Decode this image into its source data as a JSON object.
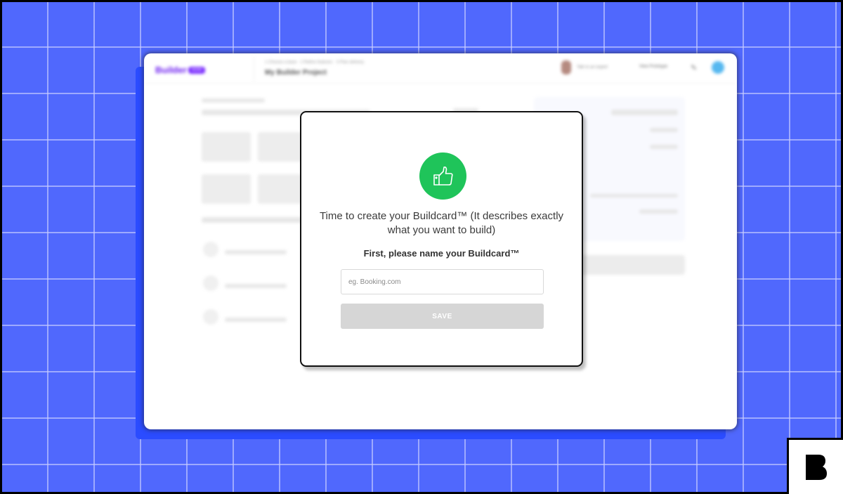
{
  "app": {
    "logo_text": "Builder",
    "logo_badge": "NOW",
    "steps": "1 Choose a base · 2 Refine features · 3 Plan delivery",
    "project_title": "My Builder Project",
    "support_label": "Talk to an expert",
    "view_prototype_label": "View Prototype",
    "icons": {
      "edit": "pencil-icon",
      "user": "user-avatar-icon"
    }
  },
  "modal": {
    "icon": "thumbs-up-icon",
    "icon_color": "#1fc45a",
    "message": "Time to create your Buildcard™ (It describes exactly what you want to build)",
    "subheading": "First, please name your Buildcard™",
    "input": {
      "value": "",
      "placeholder": "eg. Booking.com"
    },
    "save_label": "SAVE"
  },
  "brand": {
    "icon": "builder-b-logo-icon"
  },
  "colors": {
    "background": "#5068fd",
    "accent_shadow": "#2b4cff",
    "disabled_button": "#d6d6d6"
  }
}
